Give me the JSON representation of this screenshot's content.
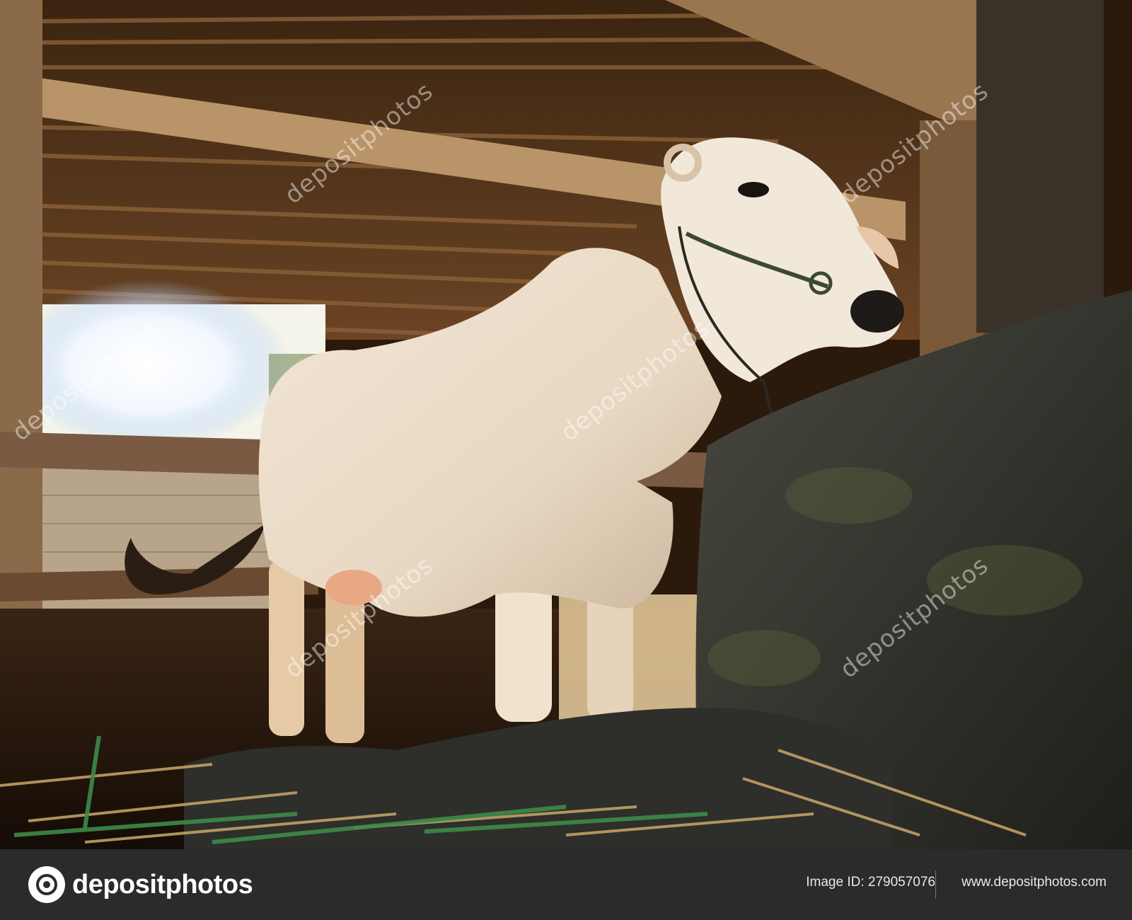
{
  "photo": {
    "subject": "white cow standing in a wooden stall",
    "watermark_text": "depositphotos"
  },
  "footer": {
    "logo_text": "depositphotos",
    "logo_icon": "camera-aperture-icon",
    "image_id_label": "Image ID:",
    "image_id_value": "279057076",
    "site_url": "www.depositphotos.com"
  },
  "colors": {
    "footer_bg": "#2b2b2b",
    "footer_text": "#ffffff"
  }
}
